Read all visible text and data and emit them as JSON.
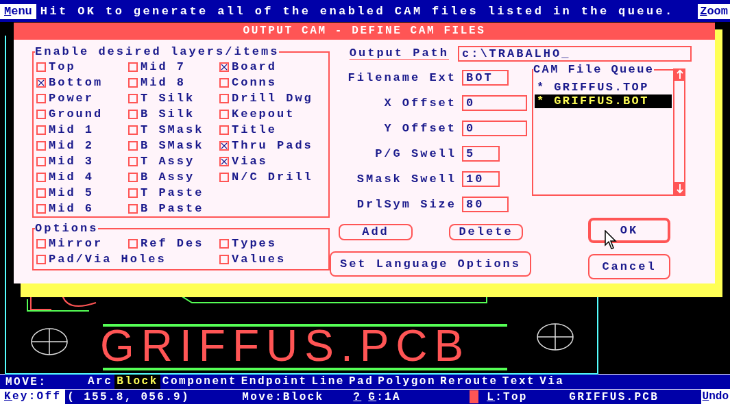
{
  "menu_bar": {
    "menu": "Menu",
    "message": "Hit OK to generate all of the enabled CAM files listed in the queue.",
    "zoom": "Zoom"
  },
  "dialog": {
    "title": "OUTPUT CAM - DEFINE CAM FILES",
    "layers": {
      "title": "Enable desired layers/items",
      "columns": [
        [
          {
            "label": "Top",
            "checked": false
          },
          {
            "label": "Bottom",
            "checked": true
          },
          {
            "label": "Power",
            "checked": false
          },
          {
            "label": "Ground",
            "checked": false
          },
          {
            "label": "Mid 1",
            "checked": false
          },
          {
            "label": "Mid 2",
            "checked": false
          },
          {
            "label": "Mid 3",
            "checked": false
          },
          {
            "label": "Mid 4",
            "checked": false
          },
          {
            "label": "Mid 5",
            "checked": false
          },
          {
            "label": "Mid 6",
            "checked": false
          }
        ],
        [
          {
            "label": "Mid 7",
            "checked": false
          },
          {
            "label": "Mid 8",
            "checked": false
          },
          {
            "label": "T Silk",
            "checked": false
          },
          {
            "label": "B Silk",
            "checked": false
          },
          {
            "label": "T SMask",
            "checked": false
          },
          {
            "label": "B SMask",
            "checked": false
          },
          {
            "label": "T Assy",
            "checked": false
          },
          {
            "label": "B Assy",
            "checked": false
          },
          {
            "label": "T Paste",
            "checked": false
          },
          {
            "label": "B Paste",
            "checked": false
          }
        ],
        [
          {
            "label": "Board",
            "checked": true
          },
          {
            "label": "Conns",
            "checked": false
          },
          {
            "label": "Drill Dwg",
            "checked": false
          },
          {
            "label": "Keepout",
            "checked": false
          },
          {
            "label": "Title",
            "checked": false
          },
          {
            "label": "Thru Pads",
            "checked": true
          },
          {
            "label": "Vias",
            "checked": true
          },
          {
            "label": "N/C Drill",
            "checked": false
          }
        ]
      ]
    },
    "options": {
      "title": "Options",
      "rows": [
        [
          {
            "label": "Mirror",
            "checked": false
          },
          {
            "label": "Ref Des",
            "checked": false
          },
          {
            "label": "Types",
            "checked": false
          }
        ],
        [
          {
            "label": "Pad/Via Holes",
            "checked": false
          },
          "",
          {
            "label": "Values",
            "checked": false
          }
        ]
      ]
    },
    "output_path": {
      "label": "Output Path",
      "value": "c:\\TRABALHO_"
    },
    "fields": [
      {
        "label": "Filename Ext",
        "value": "BOT"
      },
      {
        "label": "X Offset",
        "value": "0"
      },
      {
        "label": "Y Offset",
        "value": "0"
      },
      {
        "label": "P/G Swell",
        "value": "5"
      },
      {
        "label": "SMask Swell",
        "value": "10"
      },
      {
        "label": "DrlSym Size",
        "value": "80"
      }
    ],
    "queue": {
      "title": "CAM File Queue",
      "items": [
        {
          "text": "* GRIFFUS.TOP",
          "selected": false
        },
        {
          "text": "* GRIFFUS.BOT",
          "selected": true
        }
      ]
    },
    "buttons": {
      "add": "Add",
      "delete": "Delete",
      "language": "Set Language Options",
      "ok": "OK",
      "cancel": "Cancel"
    }
  },
  "canvas": {
    "board_text": "GRIFFUS.PCB"
  },
  "command_bar": {
    "label": "MOVE:",
    "items": [
      {
        "label": "Arc",
        "selected": false
      },
      {
        "label": "Block",
        "selected": true
      },
      {
        "label": "Component",
        "selected": false
      },
      {
        "label": "Endpoint",
        "selected": false
      },
      {
        "label": "Line",
        "selected": false
      },
      {
        "label": "Pad",
        "selected": false
      },
      {
        "label": "Polygon",
        "selected": false
      },
      {
        "label": "Reroute",
        "selected": false
      },
      {
        "label": "Text",
        "selected": false
      },
      {
        "label": "Via",
        "selected": false
      }
    ]
  },
  "status_bar": {
    "key": "Key:Off",
    "coords": "( 155.8, 056.9)",
    "mode": "Move:Block",
    "help": "?",
    "grid": "G:1A",
    "layer": "L:Top",
    "file": "GRIFFUS.PCB",
    "undo": "Undo"
  }
}
